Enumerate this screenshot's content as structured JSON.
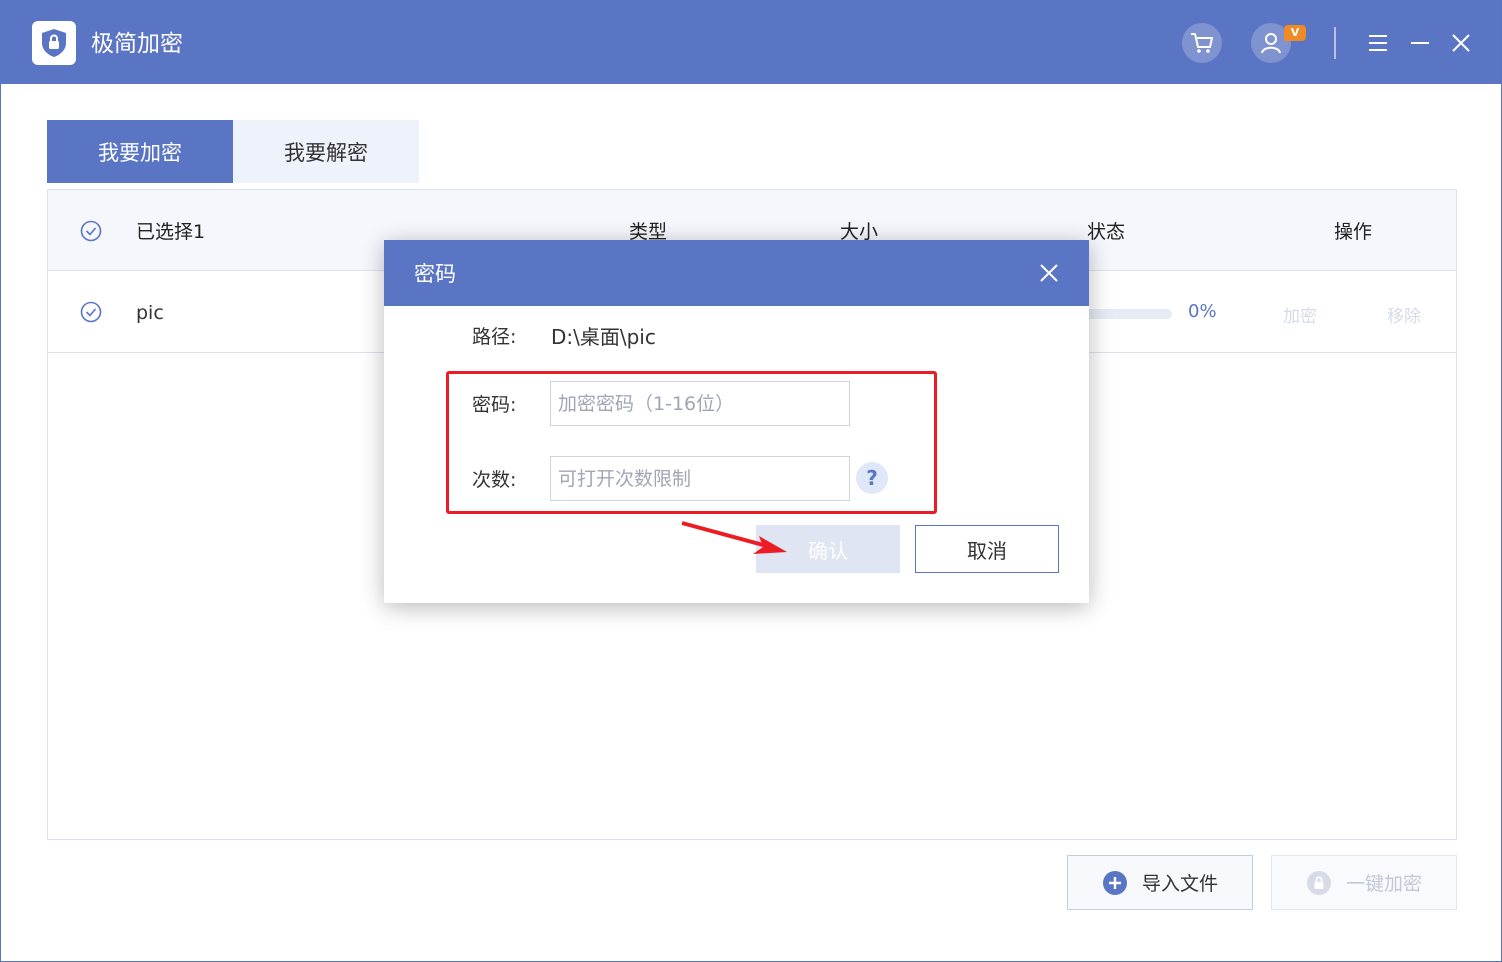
{
  "app": {
    "title": "极简加密",
    "vip_badge": "V",
    "accent_color": "#5b75c5",
    "icons": [
      "lock-shield-icon",
      "cart-icon",
      "user-icon",
      "menu-icon",
      "minimize-icon",
      "close-icon"
    ]
  },
  "tabs": [
    {
      "label": "我要加密",
      "active": true
    },
    {
      "label": "我要解密",
      "active": false
    }
  ],
  "table": {
    "headers": {
      "selected": "已选择1",
      "type": "类型",
      "size": "大小",
      "status": "状态",
      "action": "操作"
    },
    "rows": [
      {
        "name": "pic",
        "progress": "0%",
        "progress_value": 0,
        "action_encrypt": "加密",
        "action_remove": "移除"
      }
    ]
  },
  "buttons": {
    "import": "导入文件",
    "one_key_encrypt": "一键加密"
  },
  "dialog": {
    "title": "密码",
    "path_label": "路径:",
    "path_value": "D:\\桌面\\pic",
    "password_label": "密码:",
    "password_placeholder": "加密密码（1-16位）",
    "password_value": "",
    "count_label": "次数:",
    "count_placeholder": "可打开次数限制",
    "count_value": "",
    "help": "?",
    "confirm": "确认",
    "cancel": "取消"
  },
  "annotation": {
    "highlight_color": "#ec1c24"
  }
}
